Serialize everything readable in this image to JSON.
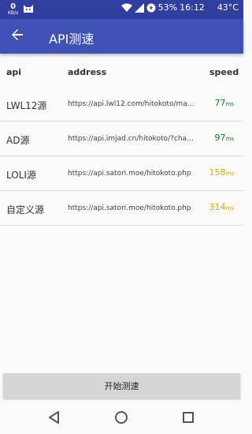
{
  "status_bar": {
    "net_speed": "0",
    "net_unit": "KB/s",
    "battery": "53%",
    "time": "16:12",
    "temperature": "43°C"
  },
  "app_bar": {
    "title": "API测速"
  },
  "table": {
    "headers": {
      "api": "api",
      "address": "address",
      "speed": "speed"
    },
    "rows": [
      {
        "name": "LWL12源",
        "address": "https://api.lwl12.com/hitokoto/main…",
        "speed": "77",
        "unit": "ms",
        "status": "fast"
      },
      {
        "name": "AD源",
        "address": "https://api.imjad.cn/hitokoto/?chars…",
        "speed": "97",
        "unit": "ms",
        "status": "fast"
      },
      {
        "name": "LOLI源",
        "address": "https://api.satori.moe/hitokoto.php",
        "speed": "158",
        "unit": "ms",
        "status": "slow"
      },
      {
        "name": "自定义源",
        "address": "https://api.satori.moe/hitokoto.php",
        "speed": "314",
        "unit": "ms",
        "status": "slow"
      }
    ]
  },
  "start_button": {
    "label": "开始测速"
  },
  "colors": {
    "status_bar": "#303f9f",
    "app_bar": "#3f51b5",
    "fast": "#1b7a1b",
    "slow": "#e6a700"
  },
  "icons": {
    "back": "arrow-left-icon",
    "nav_back": "triangle-back-icon",
    "nav_home": "circle-home-icon",
    "nav_recent": "square-recent-icon"
  }
}
